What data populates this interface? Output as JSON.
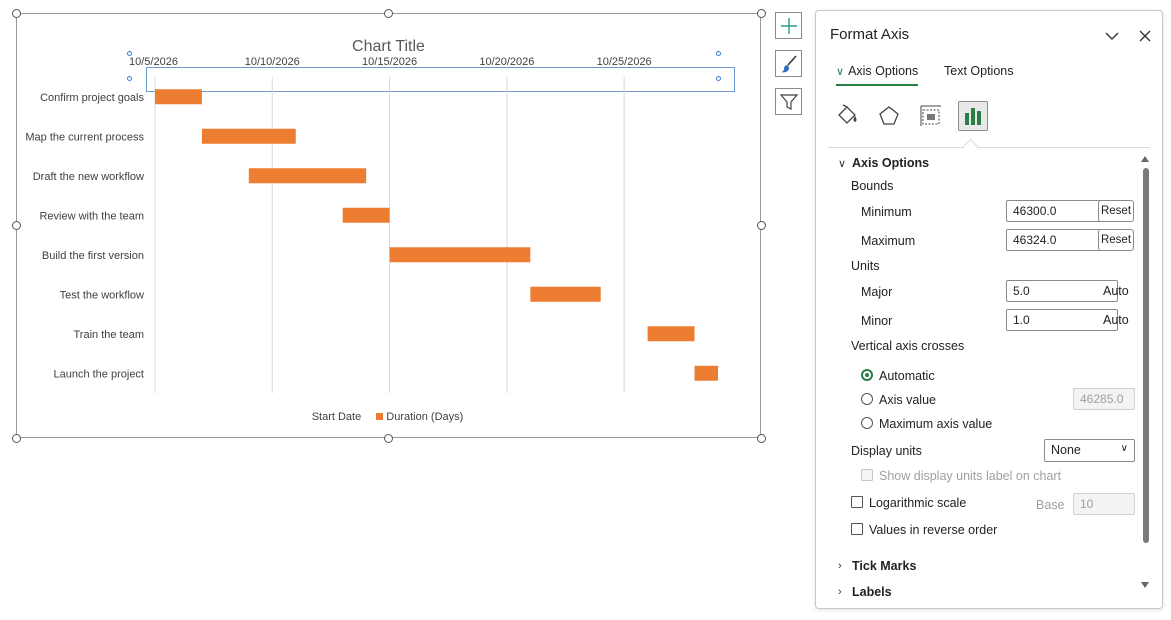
{
  "chart": {
    "title": "Chart Title",
    "legend": {
      "series1": "Start Date",
      "series2": "Duration (Days)"
    },
    "axis_min": 46300,
    "axis_max": 46324,
    "ticks": [
      {
        "value": 46300,
        "label": "10/5/2026"
      },
      {
        "value": 46305,
        "label": "10/10/2026"
      },
      {
        "value": 46310,
        "label": "10/15/2026"
      },
      {
        "value": 46315,
        "label": "10/20/2026"
      },
      {
        "value": 46320,
        "label": "10/25/2026"
      }
    ]
  },
  "chart_data": {
    "type": "bar",
    "orientation": "horizontal",
    "stacked": true,
    "title": "Chart Title",
    "categories": [
      "Confirm project goals",
      "Map the current process",
      "Draft the new workflow",
      "Review with the team",
      "Build the first version",
      "Test the workflow",
      "Train the team",
      "Launch the project"
    ],
    "x_axis_ticks": [
      "10/5/2026",
      "10/10/2026",
      "10/15/2026",
      "10/20/2026",
      "10/25/2026"
    ],
    "xlim": [
      46300,
      46324
    ],
    "grid": true,
    "legend_position": "bottom",
    "series": [
      {
        "name": "Start Date",
        "color": "none",
        "values": [
          46300,
          46302,
          46304,
          46308,
          46310,
          46316,
          46321,
          46323
        ]
      },
      {
        "name": "Duration (Days)",
        "color": "#ED7D31",
        "values": [
          2,
          4,
          5,
          2,
          6,
          3,
          2,
          1
        ]
      }
    ]
  },
  "pane": {
    "title": "Format Axis",
    "tabs": [
      "Axis Options",
      "Text Options"
    ],
    "category_icons": [
      "fill-line-icon",
      "effects-icon",
      "size-properties-icon",
      "axis-options-icon"
    ],
    "section_axis_options": "Axis Options",
    "bounds_label": "Bounds",
    "minimum_label": "Minimum",
    "minimum_value": "46300.0",
    "maximum_label": "Maximum",
    "maximum_value": "46324.0",
    "reset_label": "Reset",
    "units_label": "Units",
    "major_label": "Major",
    "major_value": "5.0",
    "minor_label": "Minor",
    "minor_value": "1.0",
    "auto_label": "Auto",
    "vertical_axis_crosses_label": "Vertical axis crosses",
    "automatic_label": "Automatic",
    "axis_value_label": "Axis value",
    "axis_value_value": "46285.0",
    "maximum_axis_value_label": "Maximum axis value",
    "display_units_label": "Display units",
    "display_units_value": "None",
    "show_units_label": "Show display units label on chart",
    "log_scale_label": "Logarithmic scale",
    "base_label": "Base",
    "base_value": "10",
    "reverse_order_label": "Values in reverse order",
    "tick_marks_label": "Tick Marks",
    "labels_label": "Labels"
  },
  "colors": {
    "bar": "#ED7D31",
    "accent": "#2B7D46"
  }
}
